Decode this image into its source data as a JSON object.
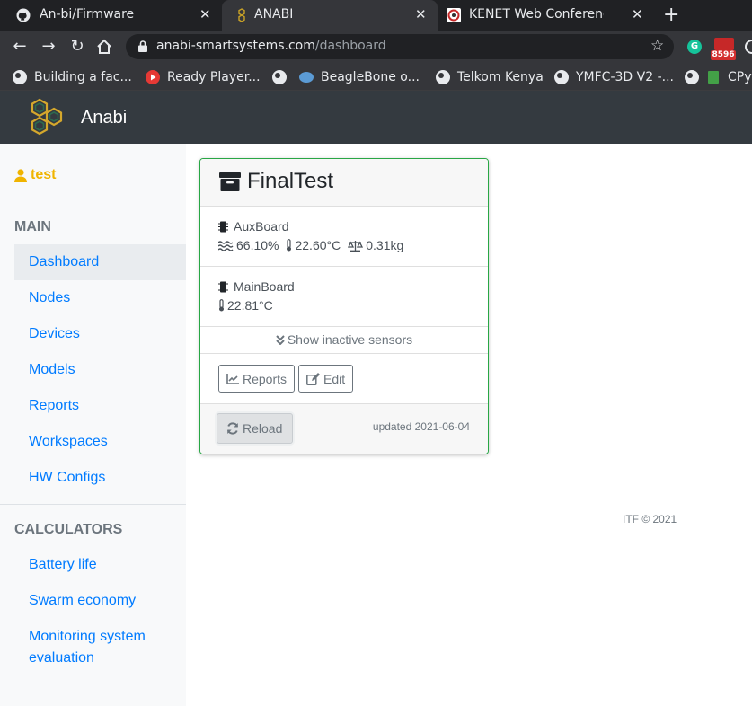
{
  "browser": {
    "tabs": [
      {
        "title": "An-bi/Firmware",
        "icon": "github-icon"
      },
      {
        "title": "ANABI",
        "icon": "anabi-favicon",
        "active": true
      },
      {
        "title": "KENET Web Conferenc",
        "icon": "kenet-favicon"
      }
    ],
    "new_tab_label": "+",
    "close_label": "✕",
    "url_host": "anabi-smartsystems.com",
    "url_path": "/dashboard",
    "extension_badge": "8596",
    "bookmarks": [
      {
        "label": "Building a fac...",
        "icon": "globe-icon"
      },
      {
        "label": "Ready Player...",
        "icon": "youtube-icon"
      },
      {
        "label": "",
        "icon": "globe-icon"
      },
      {
        "label": "BeagleBone o...",
        "icon": "beagle-icon"
      },
      {
        "label": "Telkom Kenya",
        "icon": "globe-icon"
      },
      {
        "label": "YMFC-3D V2 -...",
        "icon": "globe-icon"
      },
      {
        "label": "",
        "icon": "globe-icon"
      },
      {
        "label": "CPyt",
        "icon": "book-icon"
      }
    ]
  },
  "app": {
    "brand": "Anabi",
    "accent": "#007bff",
    "header_bg": "#343a40"
  },
  "sidebar": {
    "user": "test",
    "main_heading": "MAIN",
    "main_items": [
      "Dashboard",
      "Nodes",
      "Devices",
      "Models",
      "Reports",
      "Workspaces",
      "HW Configs"
    ],
    "active_item": "Dashboard",
    "calc_heading": "CALCULATORS",
    "calc_items": [
      "Battery life",
      "Swarm economy",
      "Monitoring system evaluation"
    ]
  },
  "node": {
    "name": "FinalTest",
    "boards": [
      {
        "name": "AuxBoard",
        "humidity": "66.10%",
        "temperature": "22.60°C",
        "weight": "0.31kg"
      },
      {
        "name": "MainBoard",
        "temperature": "22.81°C"
      }
    ],
    "inactive_label": "Show inactive sensors",
    "reports_label": "Reports",
    "edit_label": "Edit",
    "reload_label": "Reload",
    "updated": "updated 2021-06-04",
    "status_color": "#28a745"
  },
  "footer": "ITF © 2021"
}
